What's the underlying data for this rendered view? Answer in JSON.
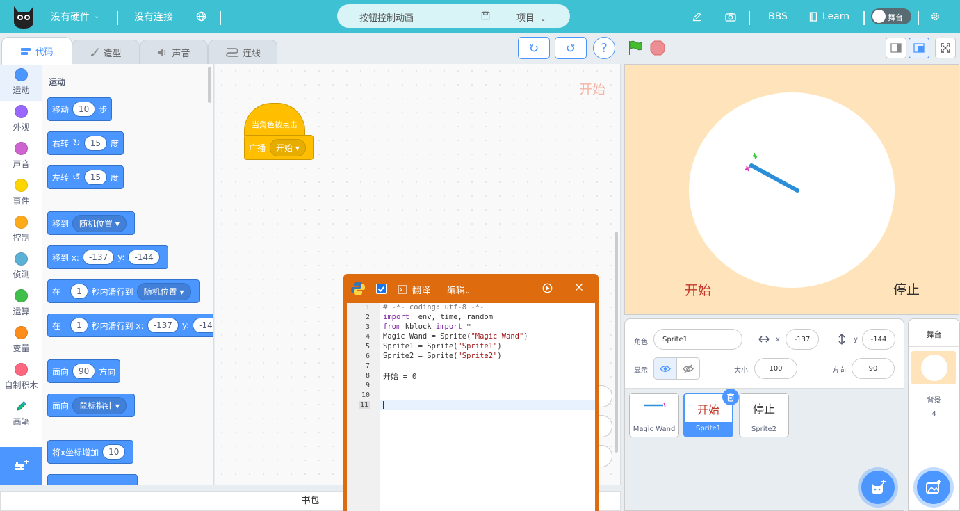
{
  "topbar": {
    "hardware": "没有硬件",
    "connection": "没有连接",
    "project_title": "按钮控制动画",
    "project_menu": "项目",
    "bbs": "BBS",
    "learn": "Learn",
    "stage_toggle": "舞台"
  },
  "tabs": [
    "代码",
    "造型",
    "声音",
    "连线"
  ],
  "categories": [
    {
      "label": "运动",
      "color": "#4c97ff"
    },
    {
      "label": "外观",
      "color": "#9966ff"
    },
    {
      "label": "声音",
      "color": "#cf63cf"
    },
    {
      "label": "事件",
      "color": "#ffd500"
    },
    {
      "label": "控制",
      "color": "#ffab19"
    },
    {
      "label": "侦测",
      "color": "#5cb1d6"
    },
    {
      "label": "运算",
      "color": "#40bf4a"
    },
    {
      "label": "变量",
      "color": "#ff8c1a"
    },
    {
      "label": "自制积木",
      "color": "#ff6680"
    },
    {
      "label": "画笔",
      "color": ""
    }
  ],
  "palette": {
    "heading": "运动",
    "blocks": {
      "move": {
        "a": "移动",
        "v": "10",
        "b": "步"
      },
      "turn_right": {
        "a": "右转",
        "v": "15",
        "b": "度"
      },
      "turn_left": {
        "a": "左转",
        "v": "15",
        "b": "度"
      },
      "goto_random": {
        "a": "移到",
        "dd": "随机位置"
      },
      "goto_xy": {
        "a": "移到 x:",
        "x": "-137",
        "ylabel": "y:",
        "y": "-144"
      },
      "glide_random": {
        "a": "在",
        "v": "1",
        "b": "秒内滑行到",
        "dd": "随机位置"
      },
      "glide_xy": {
        "a": "在",
        "v": "1",
        "b": "秒内滑行到 x:",
        "x": "-137",
        "ylabel": "y:",
        "y": "-14"
      },
      "point_dir": {
        "a": "面向",
        "v": "90",
        "b": "方向"
      },
      "point_towards": {
        "a": "面向",
        "dd": "鼠标指针"
      },
      "change_x": {
        "a": "将x坐标增加",
        "v": "10"
      }
    }
  },
  "workspace": {
    "hat": "当角色被点击",
    "broadcast": "广播",
    "broadcast_msg": "开始",
    "sprite_label": "开始"
  },
  "bag": "书包",
  "python": {
    "translate": "翻译",
    "edit": "编辑",
    "line_numbers": [
      "1",
      "2",
      "3",
      "4",
      "5",
      "6",
      "7",
      "8",
      "9",
      "10",
      "11"
    ],
    "lines": {
      "l1": "# -*- coding: utf-8 -*-",
      "l2a": "import",
      "l2b": " _env, time, random",
      "l3a": "from",
      "l3b": " kblock ",
      "l3c": "import",
      "l3d": " *",
      "l4a": "Magic Wand = Sprite(",
      "l4b": "\"Magic Wand\"",
      "l4c": ")",
      "l5a": "Sprite1 = Sprite(",
      "l5b": "\"Sprite1\"",
      "l5c": ")",
      "l6a": "Sprite2 = Sprite(",
      "l6b": "\"Sprite2\"",
      "l6c": ")",
      "l8": "开始 = 0"
    }
  },
  "stage": {
    "start": "开始",
    "stop": "停止"
  },
  "sprite_info": {
    "sprite_label": "角色",
    "sprite_name": "Sprite1",
    "x_label": "x",
    "x": "-137",
    "y_label": "y",
    "y": "-144",
    "show_label": "显示",
    "size_label": "大小",
    "size": "100",
    "direction_label": "方向",
    "direction": "90"
  },
  "sprites": [
    {
      "name": "Magic Wand",
      "thumb": ""
    },
    {
      "name": "Sprite1",
      "thumb": "开始"
    },
    {
      "name": "Sprite2",
      "thumb": "停止"
    }
  ],
  "stage_pane": {
    "title": "舞台",
    "backdrops_label": "背景",
    "backdrops_count": "4"
  },
  "colors": {
    "topbar": "#3fc1d4",
    "motion": "#4c97ff",
    "events": "#ffbf00",
    "python_panel": "#de6b0e",
    "stage_bg": "#ffe4bb"
  }
}
